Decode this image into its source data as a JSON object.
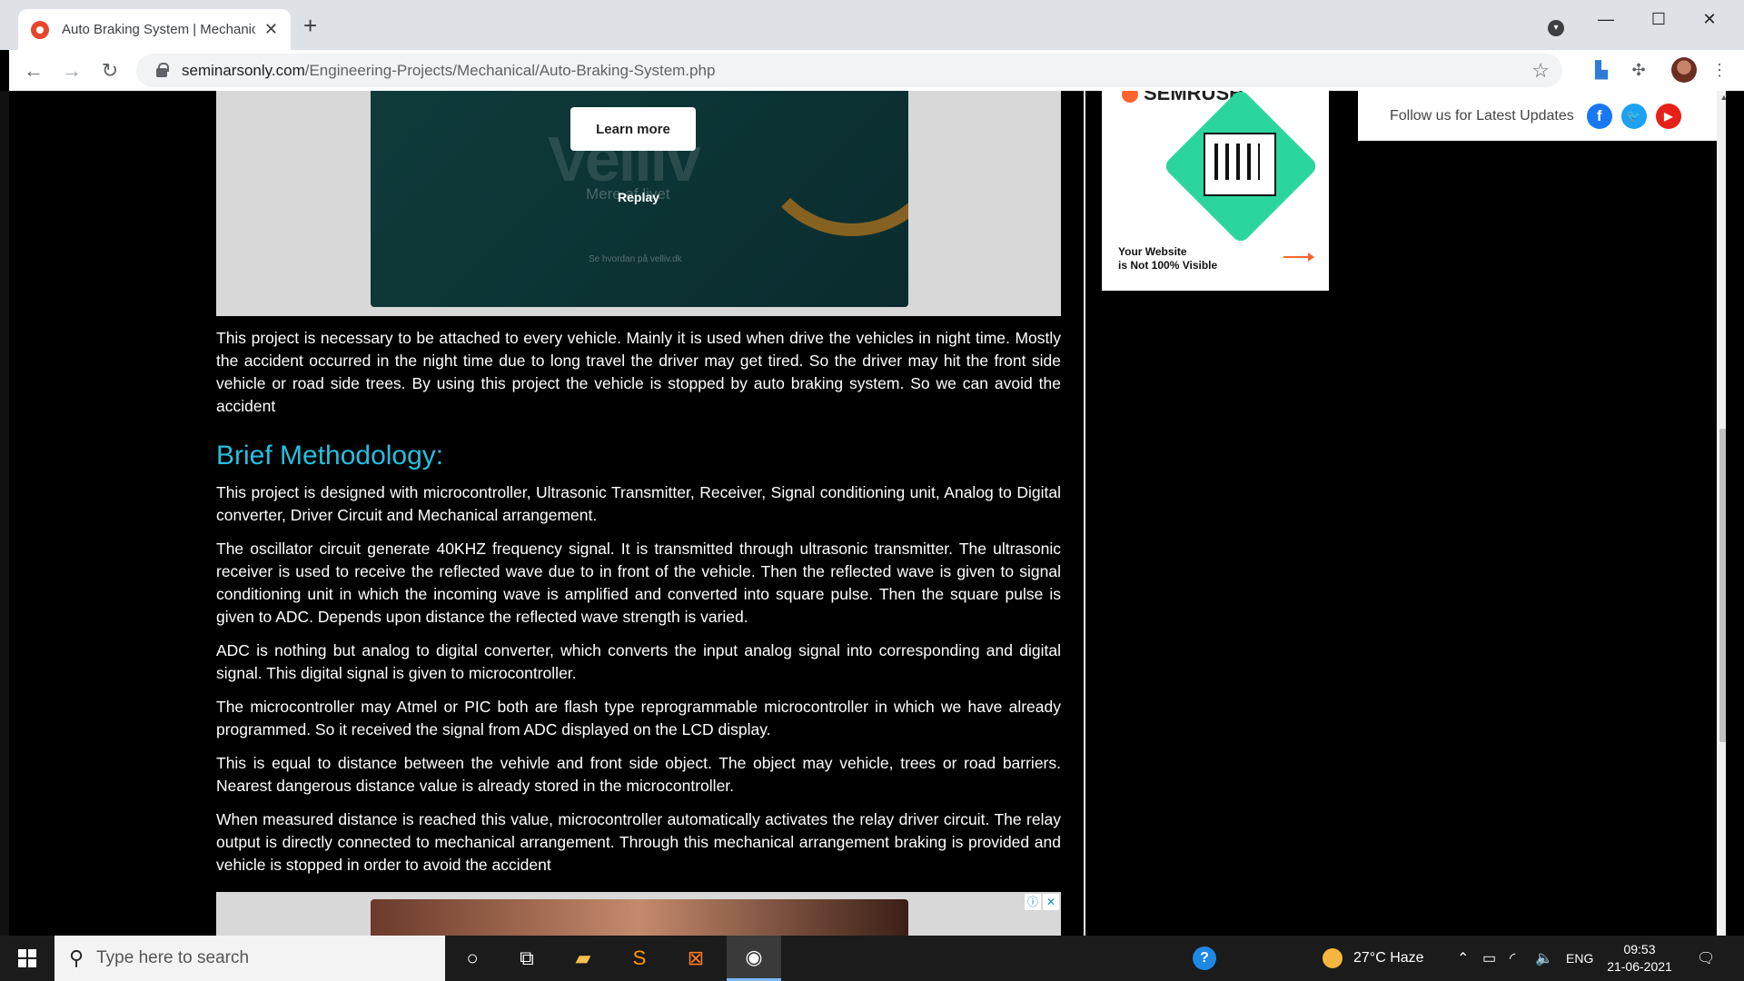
{
  "browser": {
    "tab_title": "Auto Braking System | Mechanica",
    "url_host": "seminarsonly.com",
    "url_path": "/Engineering-Projects/Mechanical/Auto-Braking-System.php"
  },
  "ad_top": {
    "brand": "Velliv",
    "tagline": "Mere af livet",
    "small_text": "Se hvordan på velliv.dk",
    "learn_more": "Learn more",
    "replay": "Replay"
  },
  "article": {
    "intro": "This project is necessary to be attached to every vehicle. Mainly it is used when drive the vehicles in night time. Mostly the accident occurred in the night time due to long travel the driver may get tired. So the driver may hit the front side vehicle or road side trees. By using this project the vehicle is stopped by auto braking system. So we can avoid the accident",
    "heading": "Brief Methodology:",
    "paragraphs": [
      "This project is designed with microcontroller, Ultrasonic Transmitter, Receiver, Signal conditioning unit, Analog to Digital converter, Driver Circuit and Mechanical arrangement.",
      "The oscillator circuit generate 40KHZ frequency signal. It is transmitted through ultrasonic transmitter. The ultrasonic receiver is used to receive the reflected wave due to in front of the vehicle. Then the reflected wave is given to signal conditioning unit in which the incoming wave is amplified and converted into square pulse. Then the square pulse is given to ADC. Depends upon distance the reflected wave strength is varied.",
      "ADC is nothing but analog to digital converter, which converts the input analog signal into corresponding and digital signal. This digital signal is given to microcontroller.",
      "The microcontroller may Atmel or PIC both are flash type reprogrammable microcontroller in which we have already programmed. So it received the signal from ADC displayed on the LCD display.",
      "This is equal to distance between the vehivle and front side object. The object may vehicle, trees or road barriers. Nearest dangerous distance value is already stored in the microcontroller.",
      "When measured distance is reached this value, microcontroller automatically activates the relay driver circuit. The relay output is directly connected to mechanical arrangement. Through this mechanical arrangement braking is provided and vehicle is stopped in order to avoid the accident"
    ]
  },
  "ad_side": {
    "brand": "SEMRUSH",
    "line1": "Your Website",
    "line2": "is Not 100% Visible"
  },
  "follow": {
    "text": "Follow us for Latest Updates"
  },
  "taskbar": {
    "search_placeholder": "Type here to search",
    "weather": "27°C  Haze",
    "language": "ENG",
    "time": "09:53",
    "date": "21-06-2021"
  },
  "icons": [
    "chrome-icon",
    "file-explorer-icon",
    "sublime-icon",
    "xampp-icon",
    "task-view-icon",
    "cortana-icon",
    "help-icon",
    "weather-icon",
    "wifi-icon",
    "volume-icon",
    "battery-icon",
    "notification-icon"
  ]
}
